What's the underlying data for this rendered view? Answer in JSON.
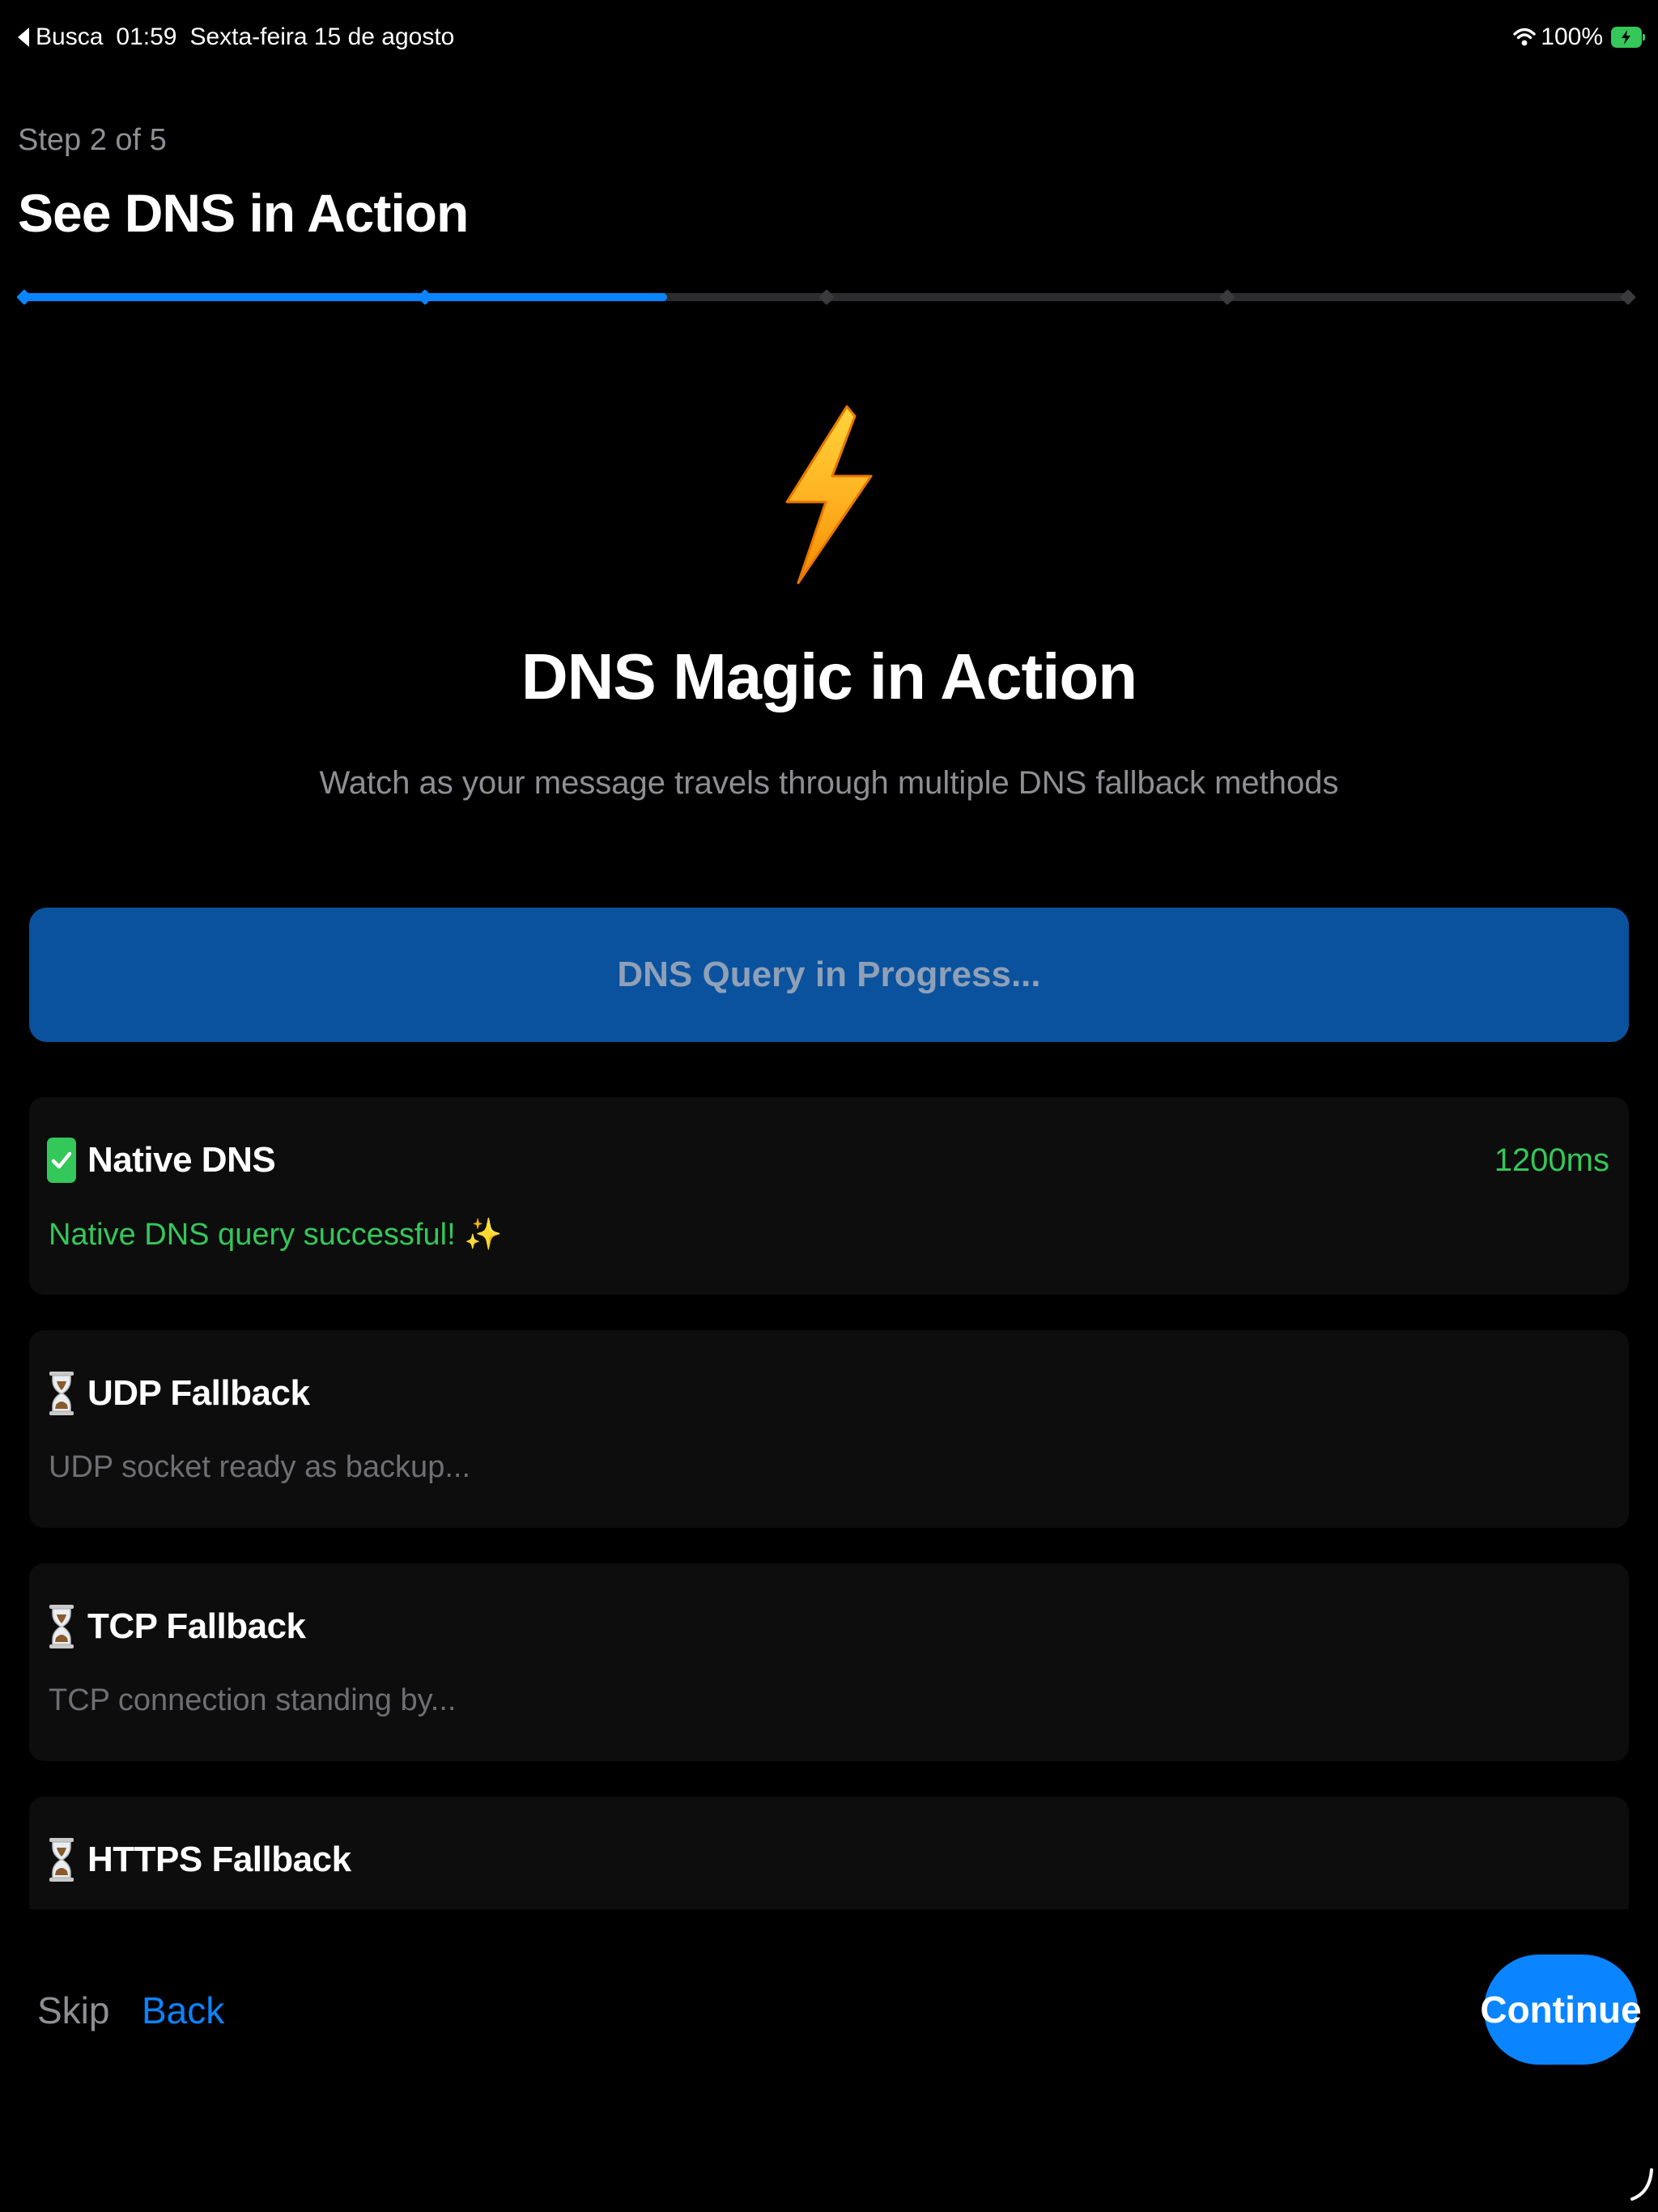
{
  "status_bar": {
    "back_app": "Busca",
    "time": "01:59",
    "date": "Sexta-feira 15 de agosto",
    "battery": "100%"
  },
  "header": {
    "step": "Step 2 of 5",
    "title": "See DNS in Action",
    "progress": {
      "current_step": 2,
      "total_steps": 5,
      "fraction": 0.4
    }
  },
  "hero": {
    "icon": "lightning-bolt-icon",
    "title": "DNS Magic in Action",
    "subtitle": "Watch as your message travels through multiple DNS fallback methods"
  },
  "query_button": {
    "label": "DNS Query in Progress..."
  },
  "methods": [
    {
      "icon": "check-icon",
      "name": "Native DNS",
      "time": "1200ms",
      "description": "Native DNS query successful! ✨",
      "state": "success"
    },
    {
      "icon": "hourglass-icon",
      "name": "UDP Fallback",
      "time": "",
      "description": "UDP socket ready as backup...",
      "state": "waiting"
    },
    {
      "icon": "hourglass-icon",
      "name": "TCP Fallback",
      "time": "",
      "description": "TCP connection standing by...",
      "state": "waiting"
    },
    {
      "icon": "hourglass-icon",
      "name": "HTTPS Fallback",
      "time": "",
      "description": "",
      "state": "waiting"
    }
  ],
  "footer": {
    "skip": "Skip",
    "back": "Back",
    "continue": "Continue"
  },
  "colors": {
    "accent": "#0a84ff",
    "success": "#34c759",
    "background": "#000000",
    "card": "#0d0d0d"
  }
}
